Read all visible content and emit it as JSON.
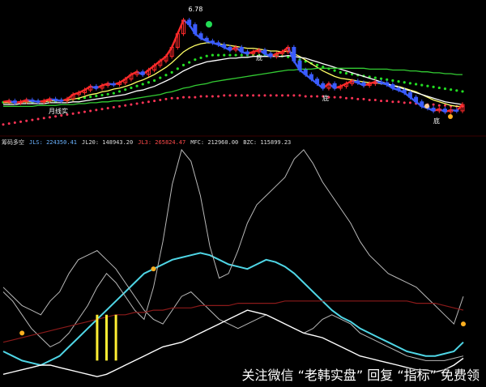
{
  "top_panel": {
    "price_high_label": "6.78",
    "label_month": "月线实",
    "label_a": "底",
    "label_b": "底",
    "label_c": "底"
  },
  "indicator_bar": {
    "title": "筹码多空",
    "jls_label": "JLS: 224350.41",
    "jl20_label": "JL20: 148943.20",
    "jl3_label": "JL3: 265824.47",
    "mfc_label": "MFC: 212960.00",
    "bzc_label": "BZC: 115899.23"
  },
  "watermark": "关注微信 “老韩实盘” 回复 “指标” 免费领",
  "colors": {
    "up_candle": "#ff2a2a",
    "down_candle": "#3a5cff",
    "ma_white": "#ffffff",
    "ma_yellow": "#ffff66",
    "ma_green": "#33cc33",
    "dot_green": "#22dd22",
    "dot_red": "#ff3355",
    "line_cyan": "#4fd6e6",
    "line_gray": "#b8b8b8",
    "line_white": "#ffffff",
    "line_darkred": "#8b1a1a",
    "bar_yellow": "#ffee33",
    "marker_gold": "#ffb020",
    "jls_color": "#6ab3ff",
    "jl20_color": "#dddddd",
    "jl3_color": "#ff4a4a",
    "mfc_color": "#dddddd",
    "bzc_color": "#dddddd"
  },
  "chart_data": [
    {
      "type": "line",
      "title": "",
      "x": [
        0,
        1,
        2,
        3,
        4,
        5,
        6,
        7,
        8,
        9,
        10,
        11,
        12,
        13,
        14,
        15,
        16,
        17,
        18,
        19,
        20,
        21,
        22,
        23,
        24,
        25,
        26,
        27,
        28,
        29,
        30,
        31,
        32,
        33,
        34,
        35,
        36,
        37,
        38,
        39,
        40,
        41,
        42,
        43,
        44,
        45,
        46,
        47,
        48,
        49,
        50,
        51,
        52,
        53,
        54,
        55,
        56,
        57,
        58,
        59,
        60,
        61,
        62,
        63,
        64,
        65,
        66,
        67,
        68,
        69,
        70,
        71,
        72,
        73,
        74,
        75,
        76,
        77,
        78,
        79
      ],
      "ylim": [
        5.5,
        6.9
      ],
      "series": [
        {
          "values": [
            5.85,
            5.86,
            5.84,
            5.85,
            5.87,
            5.86,
            5.85,
            5.86,
            5.88,
            5.87,
            5.86,
            5.88,
            5.93,
            5.95,
            5.98,
            6.02,
            6.0,
            6.03,
            6.05,
            6.04,
            6.06,
            6.1,
            6.15,
            6.18,
            6.15,
            6.2,
            6.25,
            6.3,
            6.35,
            6.45,
            6.6,
            6.75,
            6.7,
            6.6,
            6.55,
            6.52,
            6.5,
            6.48,
            6.45,
            6.42,
            6.45,
            6.4,
            6.38,
            6.4,
            6.42,
            6.38,
            6.35,
            6.38,
            6.4,
            6.45,
            6.3,
            6.2,
            6.15,
            6.1,
            6.05,
            6.0,
            6.05,
            6.0,
            6.02,
            6.05,
            6.08,
            6.06,
            6.03,
            6.05,
            6.07,
            6.06,
            6.04,
            6.0,
            5.98,
            5.95,
            5.9,
            5.85,
            5.8,
            5.78,
            5.75,
            5.77,
            5.74,
            5.76,
            5.75,
            5.82
          ]
        },
        {
          "values": [
            5.84,
            5.84,
            5.84,
            5.85,
            5.85,
            5.85,
            5.85,
            5.85,
            5.86,
            5.86,
            5.86,
            5.87,
            5.88,
            5.89,
            5.91,
            5.93,
            5.94,
            5.96,
            5.97,
            5.99,
            6.0,
            6.02,
            6.04,
            6.07,
            6.09,
            6.12,
            6.15,
            6.19,
            6.23,
            6.28,
            6.34,
            6.4,
            6.44,
            6.47,
            6.49,
            6.5,
            6.5,
            6.49,
            6.48,
            6.47,
            6.46,
            6.45,
            6.44,
            6.44,
            6.43,
            6.42,
            6.41,
            6.41,
            6.4,
            6.41,
            6.38,
            6.35,
            6.31,
            6.27,
            6.23,
            6.19,
            6.16,
            6.13,
            6.11,
            6.1,
            6.09,
            6.08,
            6.07,
            6.06,
            6.06,
            6.05,
            6.04,
            6.03,
            6.02,
            6.0,
            5.98,
            5.96,
            5.93,
            5.9,
            5.87,
            5.85,
            5.83,
            5.81,
            5.8,
            5.8
          ]
        },
        {
          "values": [
            5.82,
            5.82,
            5.82,
            5.83,
            5.83,
            5.83,
            5.83,
            5.83,
            5.84,
            5.84,
            5.84,
            5.84,
            5.85,
            5.85,
            5.86,
            5.87,
            5.88,
            5.89,
            5.9,
            5.91,
            5.92,
            5.93,
            5.95,
            5.97,
            5.98,
            6.0,
            6.02,
            6.05,
            6.08,
            6.11,
            6.15,
            6.19,
            6.22,
            6.25,
            6.27,
            6.29,
            6.3,
            6.31,
            6.32,
            6.33,
            6.33,
            6.34,
            6.34,
            6.35,
            6.35,
            6.35,
            6.35,
            6.35,
            6.35,
            6.36,
            6.35,
            6.34,
            6.33,
            6.31,
            6.29,
            6.27,
            6.25,
            6.23,
            6.21,
            6.19,
            6.17,
            6.15,
            6.13,
            6.11,
            6.09,
            6.07,
            6.05,
            6.03,
            6.01,
            5.99,
            5.97,
            5.95,
            5.93,
            5.91,
            5.89,
            5.87,
            5.85,
            5.84,
            5.83,
            5.82
          ]
        },
        {
          "values": [
            5.8,
            5.8,
            5.8,
            5.8,
            5.8,
            5.8,
            5.81,
            5.81,
            5.81,
            5.81,
            5.82,
            5.82,
            5.82,
            5.83,
            5.83,
            5.84,
            5.84,
            5.85,
            5.85,
            5.86,
            5.86,
            5.87,
            5.88,
            5.89,
            5.9,
            5.91,
            5.92,
            5.93,
            5.95,
            5.96,
            5.98,
            6.0,
            6.01,
            6.03,
            6.04,
            6.05,
            6.07,
            6.08,
            6.09,
            6.1,
            6.11,
            6.12,
            6.13,
            6.14,
            6.15,
            6.16,
            6.17,
            6.18,
            6.19,
            6.2,
            6.2,
            6.21,
            6.21,
            6.21,
            6.22,
            6.22,
            6.22,
            6.22,
            6.22,
            6.22,
            6.22,
            6.22,
            6.22,
            6.21,
            6.21,
            6.21,
            6.21,
            6.2,
            6.2,
            6.2,
            6.19,
            6.19,
            6.18,
            6.18,
            6.17,
            6.17,
            6.16,
            6.16,
            6.15,
            6.15
          ]
        },
        {
          "values": [
            5.88,
            5.88,
            5.88,
            5.88,
            5.88,
            5.88,
            5.89,
            5.89,
            5.89,
            5.89,
            5.9,
            5.9,
            5.91,
            5.92,
            5.93,
            5.94,
            5.95,
            5.96,
            5.97,
            5.98,
            6.0,
            6.02,
            6.04,
            6.06,
            6.08,
            6.1,
            6.12,
            6.15,
            6.18,
            6.21,
            6.25,
            6.29,
            6.32,
            6.35,
            6.37,
            6.39,
            6.4,
            6.4,
            6.4,
            6.4,
            6.4,
            6.4,
            6.4,
            6.4,
            6.4,
            6.4,
            6.4,
            6.4,
            6.39,
            6.38,
            6.37,
            6.35,
            6.33,
            6.31,
            6.29,
            6.27,
            6.25,
            6.23,
            6.21,
            6.2,
            6.19,
            6.18,
            6.17,
            6.16,
            6.15,
            6.14,
            6.13,
            6.12,
            6.11,
            6.1,
            6.09,
            6.08,
            6.07,
            6.06,
            6.05,
            6.04,
            6.03,
            6.02,
            6.01,
            6.0
          ]
        },
        {
          "values": [
            5.6,
            5.61,
            5.62,
            5.63,
            5.64,
            5.65,
            5.66,
            5.67,
            5.68,
            5.69,
            5.7,
            5.71,
            5.72,
            5.73,
            5.74,
            5.75,
            5.76,
            5.77,
            5.78,
            5.79,
            5.8,
            5.81,
            5.82,
            5.83,
            5.84,
            5.85,
            5.86,
            5.87,
            5.88,
            5.89,
            5.89,
            5.9,
            5.9,
            5.9,
            5.91,
            5.91,
            5.91,
            5.91,
            5.92,
            5.92,
            5.92,
            5.92,
            5.92,
            5.92,
            5.92,
            5.92,
            5.92,
            5.92,
            5.92,
            5.92,
            5.92,
            5.92,
            5.91,
            5.91,
            5.91,
            5.91,
            5.9,
            5.9,
            5.9,
            5.89,
            5.89,
            5.88,
            5.88,
            5.87,
            5.87,
            5.86,
            5.86,
            5.85,
            5.85,
            5.84,
            5.84,
            5.83,
            5.83,
            5.82,
            5.82,
            5.81,
            5.81,
            5.8,
            5.8,
            5.8
          ]
        }
      ]
    },
    {
      "type": "line",
      "title": "",
      "x": [
        0,
        1,
        2,
        3,
        4,
        5,
        6,
        7,
        8,
        9,
        10,
        11,
        12,
        13,
        14,
        15,
        16,
        17,
        18,
        19,
        20,
        21,
        22,
        23,
        24,
        25,
        26,
        27,
        28,
        29,
        30,
        31,
        32,
        33,
        34,
        35,
        36,
        37,
        38,
        39,
        40,
        41,
        42,
        43,
        44,
        45,
        46,
        47,
        48,
        49
      ],
      "ylim": [
        0,
        100
      ],
      "series": [
        {
          "values": [
            12,
            10,
            8,
            7,
            6,
            8,
            10,
            14,
            18,
            22,
            26,
            30,
            34,
            38,
            42,
            46,
            48,
            50,
            52,
            53,
            54,
            55,
            54,
            52,
            50,
            49,
            48,
            50,
            52,
            51,
            49,
            46,
            42,
            38,
            34,
            30,
            27,
            25,
            22,
            20,
            18,
            16,
            14,
            12,
            11,
            10,
            10,
            11,
            12,
            16
          ]
        },
        {
          "values": [
            38,
            34,
            28,
            22,
            18,
            14,
            16,
            20,
            26,
            32,
            40,
            46,
            42,
            36,
            30,
            26,
            40,
            60,
            85,
            100,
            95,
            80,
            58,
            44,
            46,
            56,
            68,
            76,
            80,
            84,
            88,
            96,
            100,
            94,
            86,
            80,
            74,
            68,
            60,
            54,
            50,
            46,
            44,
            42,
            40,
            36,
            32,
            28,
            24,
            36
          ]
        },
        {
          "values": [
            40,
            36,
            32,
            30,
            28,
            34,
            38,
            46,
            52,
            54,
            56,
            52,
            48,
            42,
            36,
            30,
            26,
            24,
            30,
            36,
            38,
            34,
            30,
            26,
            24,
            22,
            24,
            26,
            28,
            26,
            24,
            22,
            20,
            22,
            26,
            28,
            26,
            24,
            20,
            18,
            16,
            14,
            12,
            10,
            9,
            8,
            8,
            8,
            9,
            10
          ]
        },
        {
          "values": [
            2,
            3,
            4,
            5,
            6,
            6,
            5,
            4,
            3,
            2,
            1,
            2,
            4,
            6,
            8,
            10,
            12,
            14,
            15,
            16,
            18,
            20,
            22,
            24,
            26,
            28,
            30,
            29,
            28,
            26,
            24,
            22,
            20,
            19,
            18,
            16,
            14,
            12,
            10,
            9,
            8,
            7,
            6,
            5,
            4,
            4,
            3,
            4,
            6,
            9
          ]
        },
        {
          "values": [
            16,
            17,
            18,
            19,
            20,
            21,
            22,
            23,
            24,
            25,
            26,
            27,
            28,
            28,
            29,
            29,
            30,
            30,
            31,
            31,
            31,
            32,
            32,
            32,
            32,
            33,
            33,
            33,
            33,
            33,
            34,
            34,
            34,
            34,
            34,
            34,
            34,
            34,
            34,
            34,
            34,
            34,
            34,
            34,
            33,
            33,
            33,
            32,
            31,
            30
          ]
        }
      ]
    }
  ]
}
